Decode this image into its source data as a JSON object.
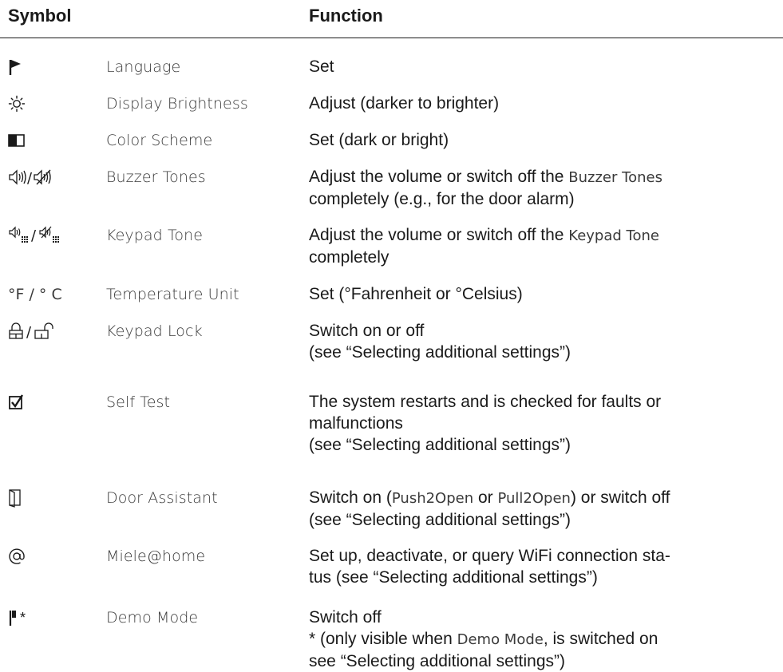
{
  "header": {
    "symbol": "Symbol",
    "function": "Function"
  },
  "rows": [
    {
      "icon": "flag-icon",
      "name": "Language",
      "function": {
        "line1": "Set"
      }
    },
    {
      "icon": "brightness-icon",
      "name": "Display Brightness",
      "function": {
        "line1": "Adjust (darker to brighter)"
      }
    },
    {
      "icon": "color-scheme-icon",
      "name": "Color Scheme",
      "function": {
        "line1": "Set (dark or bright)"
      }
    },
    {
      "icon": "speaker-icon",
      "name": "Buzzer Tones",
      "function": {
        "line1_pre": "Adjust the volume or switch off the ",
        "line1_ui": "Buzzer Tones",
        "line2": "completely (e.g., for the door alarm)"
      }
    },
    {
      "icon": "keypad-speaker-icon",
      "name": "Keypad Tone",
      "function": {
        "line1_pre": "Adjust the volume or switch off the ",
        "line1_ui": "Keypad Tone",
        "line2": "completely"
      }
    },
    {
      "icon": "temperature-unit-icon",
      "symbol_text": "°F / ° C",
      "name": "Temperature Unit",
      "function": {
        "line1": "Set (°Fahrenheit or °Celsius)"
      }
    },
    {
      "icon": "lock-icon",
      "name": "Keypad Lock",
      "function": {
        "line1": "Switch on or off",
        "line2": "(see “Selecting additional settings”)"
      }
    },
    {
      "icon": "checkbox-icon",
      "name": "Self Test",
      "function": {
        "line1": "The system restarts and is checked for faults or",
        "line2": "malfunctions",
        "line3": "(see “Selecting additional settings”)"
      }
    },
    {
      "icon": "door-icon",
      "name": "Door Assistant",
      "function": {
        "line1_pre": "Switch on (",
        "ui1": "Push2Open",
        "mid": " or ",
        "ui2": "Pull2Open",
        "post": ") or switch off",
        "line2": "(see “Selecting additional settings”)"
      }
    },
    {
      "icon": "at-icon",
      "name": "Miele@home",
      "function": {
        "line1": "Set up, deactivate, or query WiFi connection sta-",
        "line2": "tus (see “Selecting additional settings”)"
      }
    },
    {
      "icon": "demo-flag-icon",
      "symbol_text": "*",
      "name": "Demo Mode",
      "function": {
        "line1": "Switch off",
        "line2_pre": "* (only visible when ",
        "line2_ui": "Demo Mode",
        "line2_post": ", is switched on",
        "line3": "see “Selecting additional settings”)"
      }
    }
  ]
}
